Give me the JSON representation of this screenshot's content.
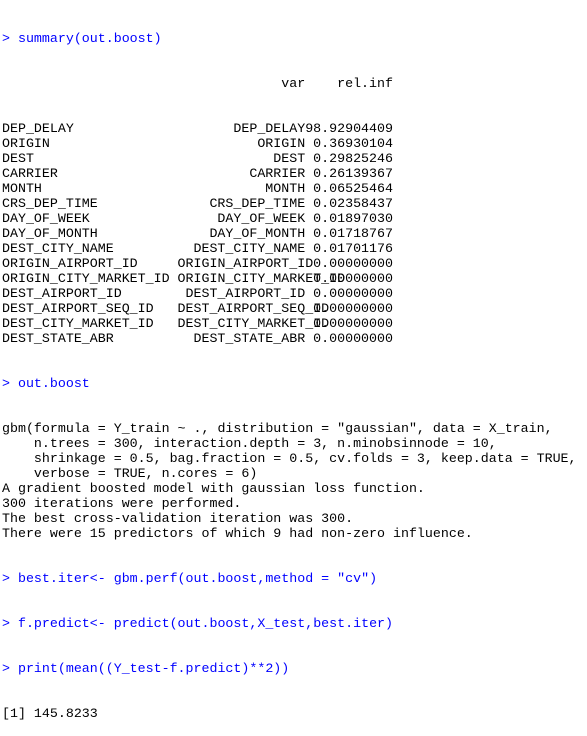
{
  "prompt": ">",
  "commands": {
    "summary": "summary(out.boost)",
    "print_model": "out.boost",
    "best_iter": "best.iter<- gbm.perf(out.boost,method = \"cv\")",
    "predict": "f.predict<- predict(out.boost,X_test,best.iter)",
    "mse": "print(mean((Y_test-f.predict)**2))"
  },
  "summary_table": {
    "headers": {
      "var": "var",
      "rel_inf": "rel.inf"
    },
    "rows": [
      {
        "name": "DEP_DELAY",
        "var": "DEP_DELAY",
        "rel_inf": "98.92904409"
      },
      {
        "name": "ORIGIN",
        "var": "ORIGIN",
        "rel_inf": "0.36930104"
      },
      {
        "name": "DEST",
        "var": "DEST",
        "rel_inf": "0.29825246"
      },
      {
        "name": "CARRIER",
        "var": "CARRIER",
        "rel_inf": "0.26139367"
      },
      {
        "name": "MONTH",
        "var": "MONTH",
        "rel_inf": "0.06525464"
      },
      {
        "name": "CRS_DEP_TIME",
        "var": "CRS_DEP_TIME",
        "rel_inf": "0.02358437"
      },
      {
        "name": "DAY_OF_WEEK",
        "var": "DAY_OF_WEEK",
        "rel_inf": "0.01897030"
      },
      {
        "name": "DAY_OF_MONTH",
        "var": "DAY_OF_MONTH",
        "rel_inf": "0.01718767"
      },
      {
        "name": "DEST_CITY_NAME",
        "var": "DEST_CITY_NAME",
        "rel_inf": "0.01701176"
      },
      {
        "name": "ORIGIN_AIRPORT_ID",
        "var": "ORIGIN_AIRPORT_ID",
        "rel_inf": "0.00000000"
      },
      {
        "name": "ORIGIN_CITY_MARKET_ID",
        "var": "ORIGIN_CITY_MARKET_ID",
        "rel_inf": "0.00000000"
      },
      {
        "name": "DEST_AIRPORT_ID",
        "var": "DEST_AIRPORT_ID",
        "rel_inf": "0.00000000"
      },
      {
        "name": "DEST_AIRPORT_SEQ_ID",
        "var": "DEST_AIRPORT_SEQ_ID",
        "rel_inf": "0.00000000"
      },
      {
        "name": "DEST_CITY_MARKET_ID",
        "var": "DEST_CITY_MARKET_ID",
        "rel_inf": "0.00000000"
      },
      {
        "name": "DEST_STATE_ABR",
        "var": "DEST_STATE_ABR",
        "rel_inf": "0.00000000"
      }
    ]
  },
  "model_output": [
    "gbm(formula = Y_train ~ ., distribution = \"gaussian\", data = X_train,",
    "    n.trees = 300, interaction.depth = 3, n.minobsinnode = 10,",
    "    shrinkage = 0.5, bag.fraction = 0.5, cv.folds = 3, keep.data = TRUE,",
    "    verbose = TRUE, n.cores = 6)",
    "A gradient boosted model with gaussian loss function.",
    "300 iterations were performed.",
    "The best cross-validation iteration was 300.",
    "There were 15 predictors of which 9 had non-zero influence."
  ],
  "mse_result": "[1] 145.8233",
  "colors": {
    "command": "#0000ff",
    "output": "#000000"
  }
}
